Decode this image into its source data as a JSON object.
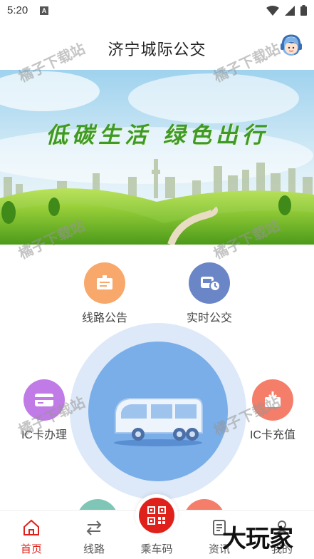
{
  "status_bar": {
    "time": "5:20",
    "notification_icon": "A"
  },
  "header": {
    "title": "济宁城际公交",
    "service_icon": "customer-service-icon"
  },
  "banner": {
    "slogan": "低碳生活 绿色出行"
  },
  "features": {
    "route_notice": {
      "label": "线路公告",
      "color": "#f7a86a"
    },
    "realtime_bus": {
      "label": "实时公交",
      "color": "#6b86c6"
    },
    "ic_card_apply": {
      "label": "IC卡办理",
      "color": "#c07be6"
    },
    "ic_card_recharge": {
      "label": "IC卡充值",
      "color": "#f47e6a"
    }
  },
  "tabbar": {
    "home": {
      "label": "首页",
      "active": true
    },
    "routes": {
      "label": "线路"
    },
    "ride_code": {
      "label": "乘车码"
    },
    "news": {
      "label": "资讯"
    },
    "mine": {
      "label": "我的"
    }
  },
  "colors": {
    "accent": "#e0211b",
    "center_bus": "#7aaee8",
    "ring": "#dde9f8"
  },
  "watermarks": {
    "text": "橘子下载站",
    "brand": "大玩家"
  }
}
